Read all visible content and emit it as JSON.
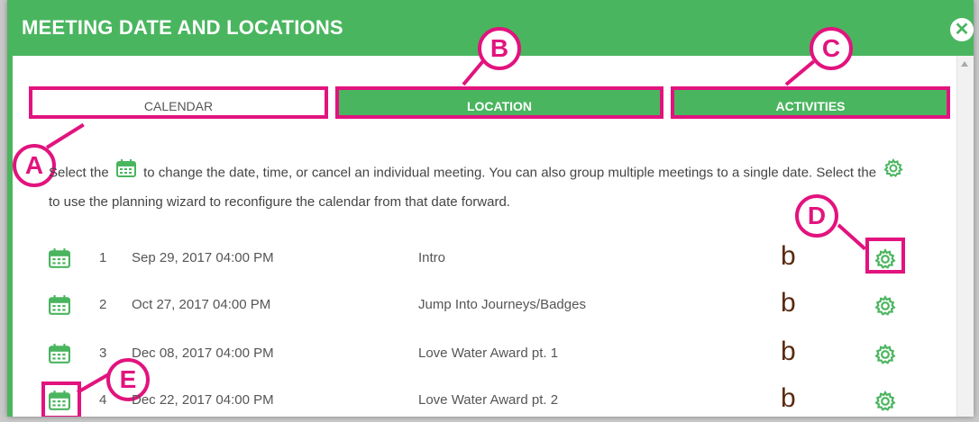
{
  "dialog": {
    "title": "MEETING DATE AND LOCATIONS",
    "close_glyph": "✕"
  },
  "tabs": [
    {
      "label": "CALENDAR",
      "active": true
    },
    {
      "label": "LOCATION",
      "active": false
    },
    {
      "label": "ACTIVITIES",
      "active": false
    }
  ],
  "callouts": {
    "a": "A",
    "b": "B",
    "c": "C",
    "d": "D",
    "e": "E"
  },
  "description": {
    "part1": "Select the",
    "part2": "to change the date, time, or cancel an individual meeting. You can also group multiple meetings to a single date. Select the",
    "part3": "to use the planning wizard to reconfigure the calendar from that date forward."
  },
  "meetings": [
    {
      "num": "1",
      "date": "Sep 29, 2017 04:00 PM",
      "title": "Intro",
      "b": "b"
    },
    {
      "num": "2",
      "date": "Oct 27, 2017 04:00 PM",
      "title": "Jump Into Journeys/Badges",
      "b": "b"
    },
    {
      "num": "3",
      "date": "Dec 08, 2017 04:00 PM",
      "title": "Love Water Award pt. 1",
      "b": "b"
    },
    {
      "num": "4",
      "date": "Dec 22, 2017 04:00 PM",
      "title": "Love Water Award pt. 2",
      "b": "b"
    }
  ],
  "icons": {
    "calendar": "calendar-icon",
    "gear": "gear-icon",
    "close": "close-icon"
  },
  "colors": {
    "accent": "#4ab55f",
    "annotation": "#e2137e",
    "b_glyph": "#5a2a10"
  }
}
